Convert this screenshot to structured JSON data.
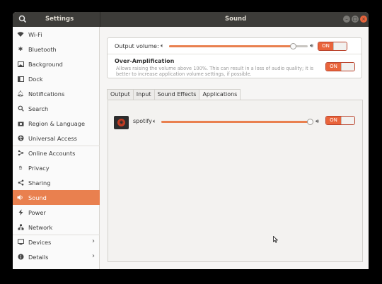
{
  "window": {
    "left_title": "Settings",
    "title": "Sound",
    "buttons": [
      "minimize",
      "maximize",
      "close"
    ]
  },
  "sidebar": {
    "items": [
      {
        "label": "Wi-Fi",
        "icon": "wifi-icon"
      },
      {
        "label": "Bluetooth",
        "icon": "bluetooth-icon"
      },
      {
        "label": "Background",
        "icon": "background-icon"
      },
      {
        "label": "Dock",
        "icon": "dock-icon"
      },
      {
        "label": "Notifications",
        "icon": "bell-icon"
      },
      {
        "label": "Search",
        "icon": "search-icon"
      },
      {
        "label": "Region & Language",
        "icon": "camera-icon"
      },
      {
        "label": "Universal Access",
        "icon": "accessibility-icon"
      },
      {
        "label": "Online Accounts",
        "icon": "share-icon"
      },
      {
        "label": "Privacy",
        "icon": "hand-icon"
      },
      {
        "label": "Sharing",
        "icon": "sharing-icon"
      },
      {
        "label": "Sound",
        "icon": "speaker-icon",
        "active": true
      },
      {
        "label": "Power",
        "icon": "power-icon"
      },
      {
        "label": "Network",
        "icon": "network-icon"
      },
      {
        "label": "Devices",
        "icon": "devices-icon",
        "chevron": true
      },
      {
        "label": "Details",
        "icon": "info-icon",
        "chevron": true
      }
    ]
  },
  "output": {
    "label": "Output volume:",
    "toggle": "ON",
    "level": 0.9
  },
  "amplification": {
    "title": "Over-Amplification",
    "description": "Allows raising the volume above 100%. This can result in a loss of audio quality; it is better to increase application volume settings, if possible.",
    "toggle": "ON"
  },
  "tabs": [
    "Output",
    "Input",
    "Sound Effects",
    "Applications"
  ],
  "active_tab": "Applications",
  "apps": [
    {
      "name": "spotify",
      "level": 1.0,
      "toggle": "ON"
    }
  ],
  "colors": {
    "accent": "#e9804f",
    "close": "#e9643b",
    "headerbar": "#3d3c39"
  }
}
